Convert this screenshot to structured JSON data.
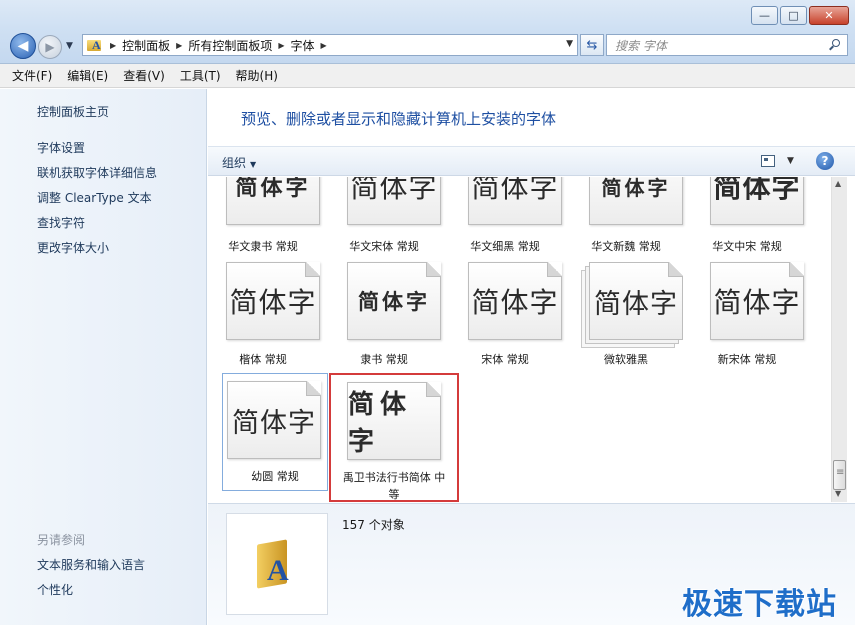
{
  "window": {
    "min_glyph": "—",
    "max_glyph": "□",
    "close_glyph": "✕"
  },
  "address": {
    "crumbs": [
      "控制面板",
      "所有控制面板项",
      "字体"
    ],
    "search_placeholder": "搜索 字体"
  },
  "menu": [
    "文件(F)",
    "编辑(E)",
    "查看(V)",
    "工具(T)",
    "帮助(H)"
  ],
  "left_pane": {
    "links": [
      "控制面板主页",
      "字体设置",
      "联机获取字体详细信息",
      "调整 ClearType 文本",
      "查找字符",
      "更改字体大小"
    ],
    "see_also_header": "另请参阅",
    "see_also_links": [
      "文本服务和输入语言",
      "个性化"
    ]
  },
  "main": {
    "title": "预览、删除或者显示和隐藏计算机上安装的字体",
    "organize": "组织",
    "help": "?"
  },
  "sample_text": "简体字",
  "fonts": [
    {
      "name": "华文隶书 常规"
    },
    {
      "name": "华文宋体 常规"
    },
    {
      "name": "华文细黑 常规"
    },
    {
      "name": "华文新魏 常规"
    },
    {
      "name": "华文中宋 常规"
    },
    {
      "name": "楷体 常规"
    },
    {
      "name": "隶书 常规"
    },
    {
      "name": "宋体 常规"
    },
    {
      "name": "微软雅黑"
    },
    {
      "name": "新宋体 常规"
    },
    {
      "name": "幼圆 常规"
    },
    {
      "name": "禹卫书法行书简体 中等"
    }
  ],
  "details": {
    "count": "157 个对象"
  },
  "watermark": "极速下载站",
  "colors": {
    "accent": "#1e4fa2",
    "highlight_border": "#d43b3b",
    "selected_border": "#84acdd"
  }
}
